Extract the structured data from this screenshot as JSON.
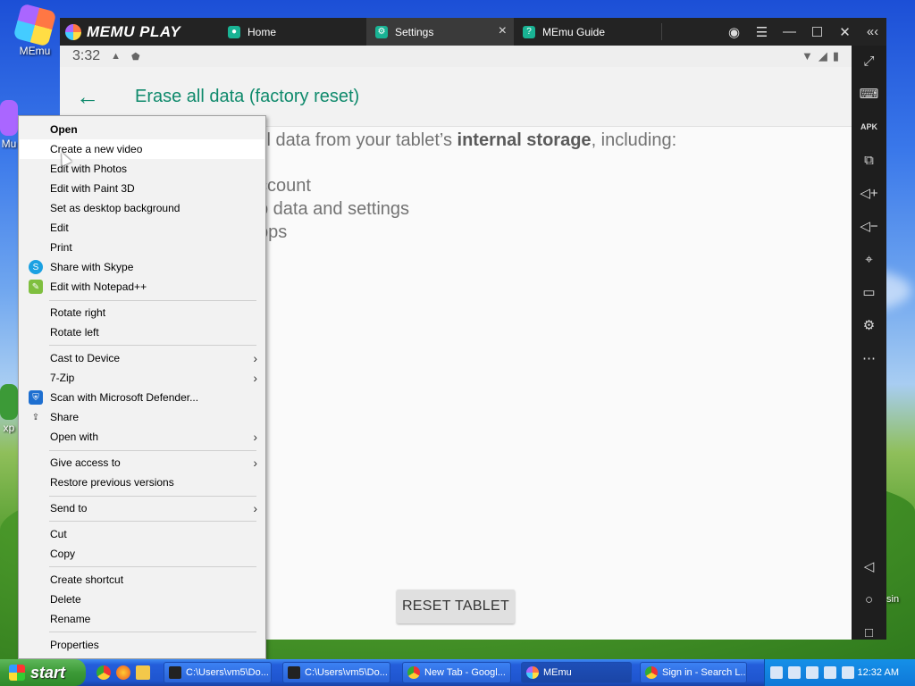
{
  "desktop": {
    "icons": [
      {
        "label": "MEmu"
      },
      {
        "label": "Mu"
      },
      {
        "label": "xp"
      }
    ],
    "right_label": "sin"
  },
  "memu": {
    "brand": "MEMU PLAY",
    "tabs": [
      {
        "label": "Home"
      },
      {
        "label": "Settings"
      },
      {
        "label": "MEmu Guide"
      }
    ]
  },
  "android": {
    "status_time": "3:32",
    "page_title": "Erase all data (factory reset)",
    "intro_pre": "ll data from your tablet’s ",
    "intro_bold": "internal storage",
    "intro_post": ", including:",
    "items": [
      "ccount",
      "p data and settings",
      "pps"
    ],
    "reset_button": "RESET TABLET"
  },
  "context_menu": {
    "items": [
      {
        "label": "Open"
      },
      {
        "label": "Create a new video"
      },
      {
        "label": "Edit with Photos"
      },
      {
        "label": "Edit with Paint 3D"
      },
      {
        "label": "Set as desktop background"
      },
      {
        "label": "Edit"
      },
      {
        "label": "Print"
      },
      {
        "label": "Share with Skype"
      },
      {
        "label": "Edit with Notepad++"
      },
      {
        "label": "Rotate right"
      },
      {
        "label": "Rotate left"
      },
      {
        "label": "Cast to Device"
      },
      {
        "label": "7-Zip"
      },
      {
        "label": "Scan with Microsoft Defender..."
      },
      {
        "label": "Share"
      },
      {
        "label": "Open with"
      },
      {
        "label": "Give access to"
      },
      {
        "label": "Restore previous versions"
      },
      {
        "label": "Send to"
      },
      {
        "label": "Cut"
      },
      {
        "label": "Copy"
      },
      {
        "label": "Create shortcut"
      },
      {
        "label": "Delete"
      },
      {
        "label": "Rename"
      },
      {
        "label": "Properties"
      }
    ]
  },
  "taskbar": {
    "start_label": "start",
    "buttons": [
      {
        "label": "C:\\Users\\vm5\\Do..."
      },
      {
        "label": "C:\\Users\\vm5\\Do..."
      },
      {
        "label": "New Tab - Googl..."
      },
      {
        "label": "MEmu"
      },
      {
        "label": "Sign in - Search L..."
      }
    ],
    "clock": "12:32 AM"
  }
}
